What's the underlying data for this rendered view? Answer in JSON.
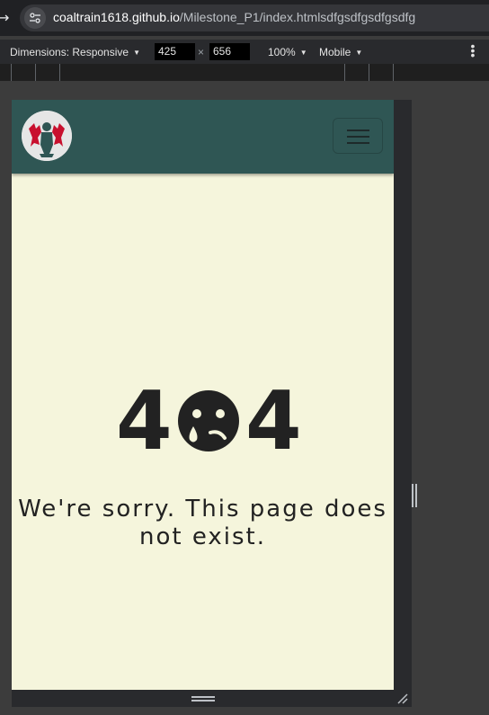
{
  "browser": {
    "url_host": "coaltrain1618.github.io",
    "url_path": "/Milestone_P1/index.htmlsdfgsdfgsdfgsdfg"
  },
  "device_toolbar": {
    "dimensions_label": "Dimensions: Responsive",
    "width": "425",
    "height": "656",
    "times": "×",
    "zoom": "100%",
    "throttle": "Mobile"
  },
  "site": {
    "nav_color": "#2f5654",
    "background_color": "#f5f5dc"
  },
  "error": {
    "digit_left": "4",
    "digit_right": "4",
    "message": "We're sorry. This page does not exist."
  }
}
